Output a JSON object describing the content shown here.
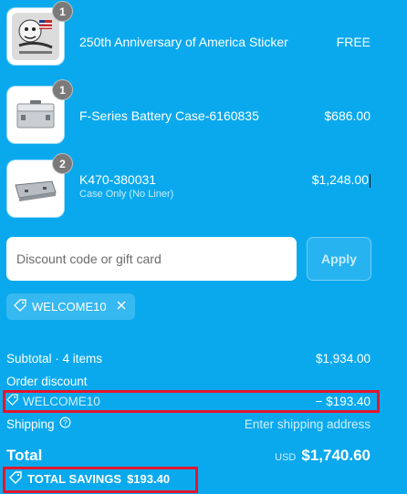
{
  "items": [
    {
      "name": "250th Anniversary of America Sticker",
      "variant": "",
      "price": "FREE",
      "quantity": "1"
    },
    {
      "name": "F-Series Battery Case-6160835",
      "variant": "",
      "price": "$686.00",
      "quantity": "1"
    },
    {
      "name": "K470-380031",
      "variant": "Case Only (No Liner)",
      "price": "$1,248.00",
      "quantity": "2"
    }
  ],
  "discount": {
    "placeholder": "Discount code or gift card",
    "apply_label": "Apply",
    "applied_code": "WELCOME10"
  },
  "summary": {
    "subtotal_label": "Subtotal · 4 items",
    "subtotal_value": "$1,934.00",
    "order_discount_label": "Order discount",
    "discount_code": "WELCOME10",
    "discount_value": "− $193.40",
    "shipping_label": "Shipping",
    "shipping_value": "Enter shipping address",
    "total_label": "Total",
    "currency": "USD",
    "total_value": "$1,740.60",
    "savings_label": "TOTAL SAVINGS",
    "savings_value": "$193.40"
  },
  "colors": {
    "background": "#0aa9ee",
    "highlight": "#e1172e"
  }
}
